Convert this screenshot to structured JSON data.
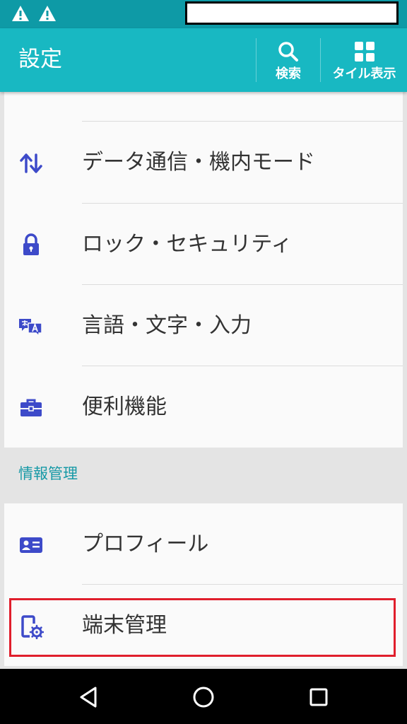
{
  "status_bar": {
    "icons": [
      "warning-icon",
      "warning-icon"
    ]
  },
  "app_bar": {
    "title": "設定",
    "actions": [
      {
        "label": "検索",
        "icon": "search-icon"
      },
      {
        "label": "タイル表示",
        "icon": "grid-icon"
      }
    ]
  },
  "groups": [
    {
      "items": [
        {
          "label": "データ通信・機内モード",
          "icon": "data-transfer-icon"
        },
        {
          "label": "ロック・セキュリティ",
          "icon": "lock-icon"
        },
        {
          "label": "言語・文字・入力",
          "icon": "language-icon"
        },
        {
          "label": "便利機能",
          "icon": "toolbox-icon"
        }
      ]
    },
    {
      "title": "情報管理",
      "items": [
        {
          "label": "プロフィール",
          "icon": "profile-card-icon"
        },
        {
          "label": "端末管理",
          "icon": "device-settings-icon"
        }
      ]
    }
  ],
  "colors": {
    "status_bar": "#0e9aa6",
    "app_bar": "#18b8c2",
    "icon_accent": "#3d4ac9",
    "section_title": "#1699a6",
    "highlight": "#e01e2c"
  },
  "navigation": {
    "buttons": [
      "back-icon",
      "home-icon",
      "recent-apps-icon"
    ]
  }
}
